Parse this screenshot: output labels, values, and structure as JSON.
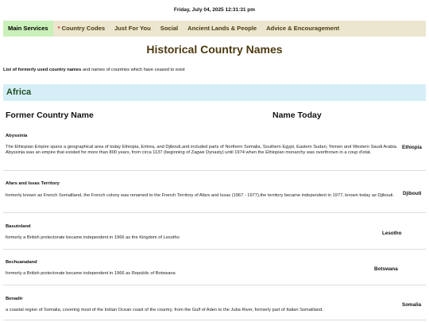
{
  "header": {
    "datetime": "Friday, July 04, 2025 12:31:31 pm"
  },
  "nav": {
    "items": [
      {
        "label": "Main Services"
      },
      {
        "star": "*",
        "label": "Country Codes"
      },
      {
        "label": "Just For You"
      },
      {
        "label": "Social"
      },
      {
        "label": "Ancient Lands & People"
      },
      {
        "label": "Advice & Encouragement"
      }
    ]
  },
  "page": {
    "title": "Historical Country Names",
    "intro_bold": "List of formerly used country names",
    "intro_rest": " and names of countries which have ceased to exist"
  },
  "region": {
    "label": "Africa"
  },
  "columns": {
    "former": "Former Country Name",
    "today": "Name Today"
  },
  "entries": [
    {
      "name": "Abyssinia",
      "desc": "The Ethiopian Empire spans a geographical area of today Ethiopia, Eritrea, and Djibouti,and included parts of Northern Somalia, Southern Egypt, Eastern Sudan, Yemen and Western Saudi Arabia. Abyssinia was an empire that existed for more than 800 years, from circa 1137 (beginning of Zagwe Dynasty) until 1974 when the Ethiopian monarchy was overthrown in a coup d'etat.",
      "today": "Ethiopia"
    },
    {
      "name": "Afars and Issas Territory",
      "desc": "formerly known as French Somaliland, the French colony was renamed to the French Territory of Afars and Issas (1967 - 1977),the territory became independent in 1977, known today as Djibouti.",
      "today": "Djibouti"
    },
    {
      "name": "Basutoland",
      "desc": "formerly a British protectorate became independent in 1966 as the Kingdom of Lesotho",
      "today": "Lesotho"
    },
    {
      "name": "Bechuanaland",
      "desc": "formerly a British protectorate became independent in 1966 as Republic of Botswana",
      "today": "Botswana"
    },
    {
      "name": "Benadir",
      "desc": "a coastal region of Somalia; covering most of the Indian Ocean coast of the country, from the Gulf of Aden to the Juba River, formerly part of Italian Somaliland.",
      "today": "Somalia"
    }
  ]
}
